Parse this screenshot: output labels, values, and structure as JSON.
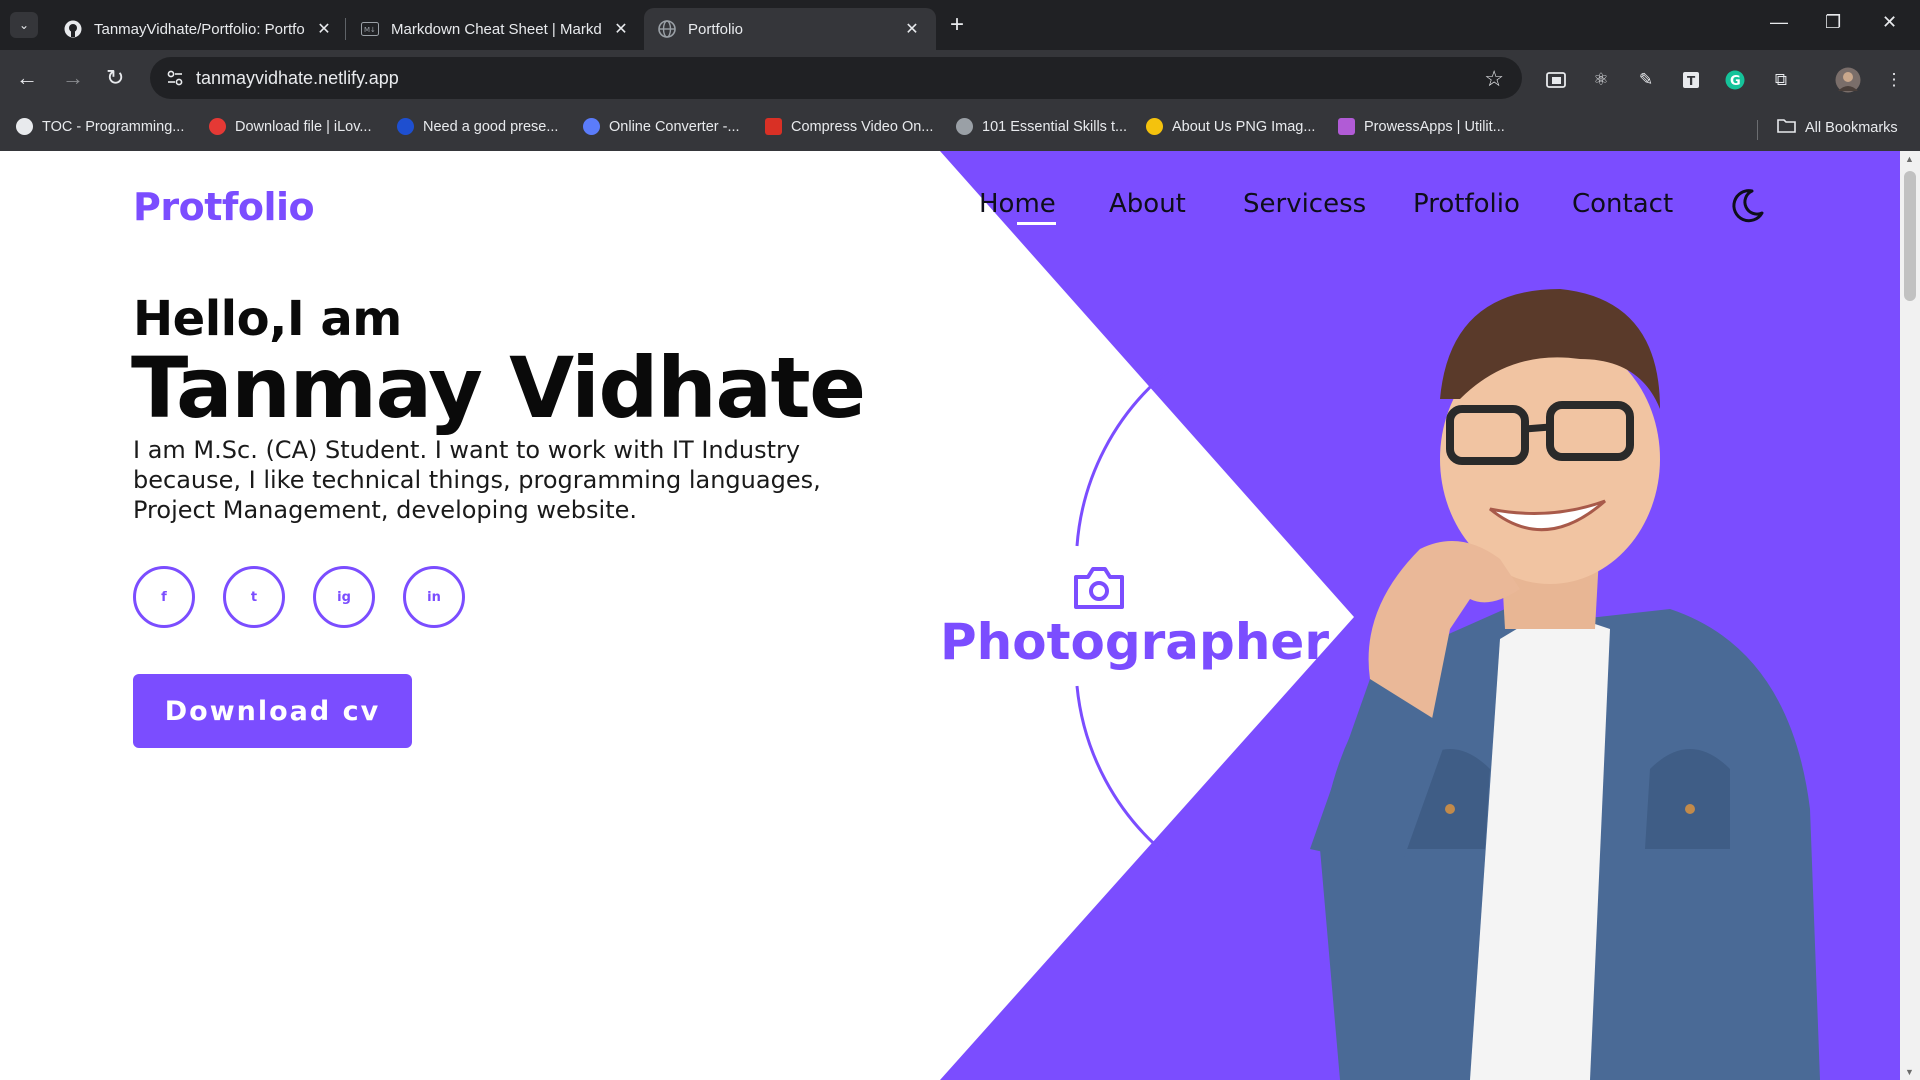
{
  "browser": {
    "tabs": [
      {
        "title": "TanmayVidhate/Portfolio: Portfo",
        "icon": "github-icon",
        "active": false
      },
      {
        "title": "Markdown Cheat Sheet | Markd",
        "icon": "markdown-icon",
        "active": false
      },
      {
        "title": "Portfolio",
        "icon": "globe-icon",
        "active": true
      }
    ],
    "address": "tanmayvidhate.netlify.app",
    "bookmarks": [
      {
        "label": "TOC - Programming...",
        "color": "#e8eaed"
      },
      {
        "label": "Download file | iLov...",
        "color": "#e53935"
      },
      {
        "label": "Need a good prese...",
        "color": "#1e4fd0"
      },
      {
        "label": "Online Converter -...",
        "color": "#5b7cfa"
      },
      {
        "label": "Compress Video On...",
        "color": "#d93025"
      },
      {
        "label": "101 Essential Skills t...",
        "color": "#9aa0a6"
      },
      {
        "label": "About Us PNG Imag...",
        "color": "#f4c20d"
      },
      {
        "label": "ProwessApps | Utilit...",
        "color": "#b15bd6"
      }
    ],
    "all_bookmarks": "All Bookmarks"
  },
  "page": {
    "logo": "Protfolio",
    "nav": [
      "Home",
      "About",
      "Servicess",
      "Protfolio",
      "Contact"
    ],
    "greeting": "Hello,I am",
    "name": "Tanmay Vidhate",
    "bio": "I am M.Sc. (CA) Student. I want to work with IT Industry because, I like technical things, programming languages, Project Management, developing website.",
    "social": [
      {
        "label": "f",
        "icon": "facebook-icon"
      },
      {
        "label": "t",
        "icon": "twitter-icon"
      },
      {
        "label": "ig",
        "icon": "instagram-icon"
      },
      {
        "label": "in",
        "icon": "linkedin-icon"
      }
    ],
    "download_label": "Download cv",
    "role": "Photographer",
    "accent": "#7b4dff"
  }
}
